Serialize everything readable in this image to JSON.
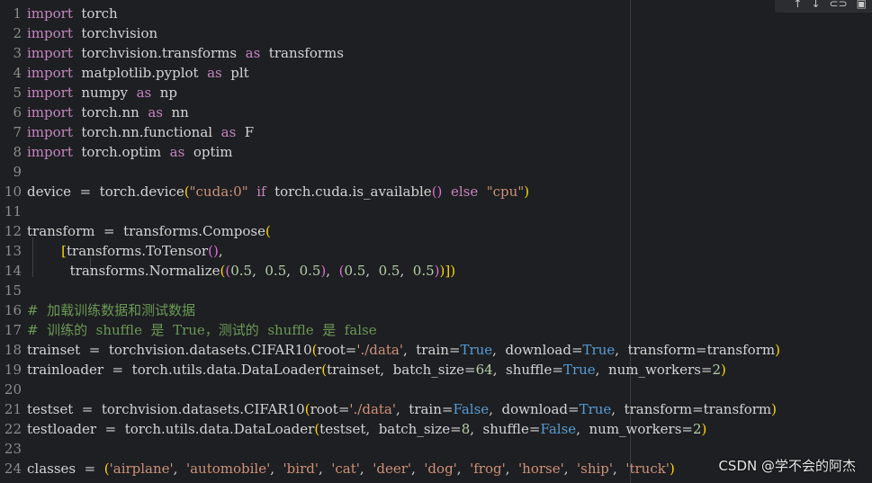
{
  "toolbar": {
    "icons": [
      "arrow-up-icon",
      "arrow-down-icon",
      "link-icon",
      "comment-icon"
    ],
    "glyphs": [
      "↑",
      "↓",
      "⊂⊃",
      "▣"
    ]
  },
  "lines": [
    {
      "n": "1",
      "code": "import  torch"
    },
    {
      "n": "2",
      "code": "import  torchvision"
    },
    {
      "n": "3",
      "code": "import  torchvision.transforms  as  transforms"
    },
    {
      "n": "4",
      "code": "import  matplotlib.pyplot  as  plt"
    },
    {
      "n": "5",
      "code": "import  numpy  as  np"
    },
    {
      "n": "6",
      "code": "import  torch.nn  as  nn"
    },
    {
      "n": "7",
      "code": "import  torch.nn.functional  as  F"
    },
    {
      "n": "8",
      "code": "import  torch.optim  as  optim"
    },
    {
      "n": "9",
      "code": ""
    },
    {
      "n": "10",
      "code": "device  =  torch.device(\"cuda:0\"  if  torch.cuda.is_available()  else  \"cpu\")"
    },
    {
      "n": "11",
      "code": ""
    },
    {
      "n": "12",
      "code": "transform  =  transforms.Compose("
    },
    {
      "n": "13",
      "code": "        [transforms.ToTensor(),"
    },
    {
      "n": "14",
      "code": "          transforms.Normalize((0.5,  0.5,  0.5),  (0.5,  0.5,  0.5))])"
    },
    {
      "n": "15",
      "code": ""
    },
    {
      "n": "16",
      "code": "#  加载训练数据和测试数据"
    },
    {
      "n": "17",
      "code": "#  训练的  shuffle  是  True，测试的  shuffle  是  false"
    },
    {
      "n": "18",
      "code": "trainset  =  torchvision.datasets.CIFAR10(root='./data',  train=True,  download=True,  transform=transform)"
    },
    {
      "n": "19",
      "code": "trainloader  =  torch.utils.data.DataLoader(trainset,  batch_size=64,  shuffle=True,  num_workers=2)"
    },
    {
      "n": "20",
      "code": ""
    },
    {
      "n": "21",
      "code": "testset  =  torchvision.datasets.CIFAR10(root='./data',  train=False,  download=True,  transform=transform)"
    },
    {
      "n": "22",
      "code": "testloader  =  torch.utils.data.DataLoader(testset,  batch_size=8,  shuffle=False,  num_workers=2)"
    },
    {
      "n": "23",
      "code": ""
    },
    {
      "n": "24",
      "code": "classes  =  ('airplane',  'automobile',  'bird',  'cat',  'deer',  'dog',  'frog',  'horse',  'ship',  'truck')"
    }
  ],
  "watermark": "CSDN @学不会的阿杰",
  "colors": {
    "background": "#1e1f22",
    "keyword": "#c586c0",
    "string": "#ce9178",
    "number": "#b5cea8",
    "boolean": "#569cd6",
    "comment": "#6a9955"
  }
}
